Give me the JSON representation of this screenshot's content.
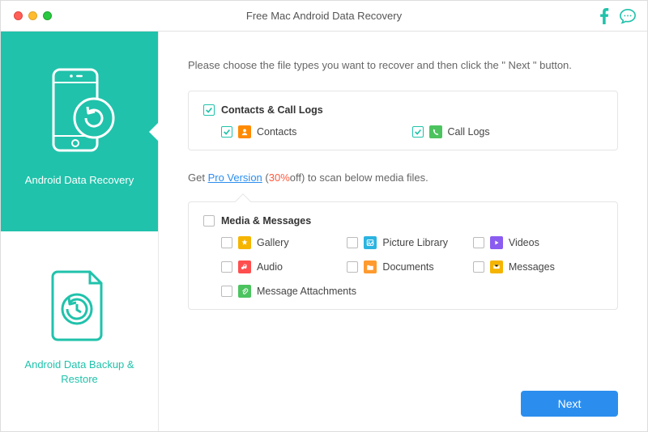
{
  "title": "Free Mac Android Data Recovery",
  "sidebar": {
    "items": [
      {
        "label": "Android Data Recovery"
      },
      {
        "label": "Android Data Backup & Restore"
      }
    ]
  },
  "main": {
    "instruction": "Please choose the file types you want to recover and then click the \" Next \" button.",
    "group1": {
      "title": "Contacts & Call Logs",
      "contacts": "Contacts",
      "calllogs": "Call Logs"
    },
    "pro": {
      "prefix": "Get ",
      "link": "Pro Version",
      "paren_open": " (",
      "off": "30%",
      "off_suffix": "off) to scan below media files."
    },
    "group2": {
      "title": "Media & Messages",
      "gallery": "Gallery",
      "picture_library": "Picture Library",
      "videos": "Videos",
      "audio": "Audio",
      "documents": "Documents",
      "messages": "Messages",
      "msg_attach": "Message Attachments"
    },
    "next": "Next"
  },
  "colors": {
    "accent": "#20c2ab",
    "blue": "#2b8eef",
    "orange": "#ff7a00",
    "green": "#4cc35f",
    "yellow": "#f5b400",
    "red": "#ff4e4e",
    "teal": "#2bb4e0",
    "purple": "#8a5cf0"
  }
}
